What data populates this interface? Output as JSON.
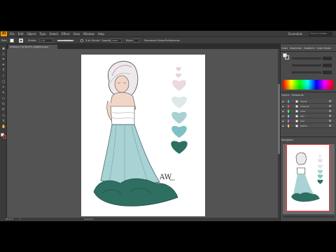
{
  "app": {
    "logo_text": "Ai",
    "menu": [
      "File",
      "Edit",
      "Object",
      "Type",
      "Select",
      "Effect",
      "View",
      "Window",
      "Help"
    ],
    "workspace": "Essentials",
    "stock_search_placeholder": "Search Adobe Stock"
  },
  "control_bar": {
    "selection_label": "Path",
    "stroke_label": "Stroke:",
    "stroke_value": "1 pt",
    "stroke_profile": "Uniform",
    "brush_label": "5 pt. Round",
    "opacity_label": "Opacity:",
    "opacity_value": "100%",
    "style_label": "Style:",
    "doc_setup_label": "Document Setup",
    "preferences_label": "Preferences"
  },
  "document": {
    "tab_title": "Untitled-1* @ 66.67% (RGB/Preview)",
    "zoom": "66.67%",
    "artboard_number": "1",
    "status_tool": "Selection"
  },
  "panels": {
    "color_tabs": [
      "Color",
      "Swatches",
      "Gradient",
      "Color Guide"
    ],
    "layers_tabs": [
      "Layers",
      "Artboards"
    ],
    "layers": [
      {
        "name": "hearts",
        "color": "#4aa3ff"
      },
      {
        "name": "linework",
        "color": "#ff4a4a"
      },
      {
        "name": "color",
        "color": "#4aff6a"
      },
      {
        "name": "skin",
        "color": "#4ad0ff"
      },
      {
        "name": "hair",
        "color": "#ff4aff"
      },
      {
        "name": "sketch",
        "color": "#ffd04a"
      }
    ],
    "navigator_title": "Navigator"
  },
  "artwork": {
    "signature": "AW",
    "signature_year": "2019",
    "hearts": [
      "#e9cdd6",
      "#ecd2db",
      "#ead9de",
      "#dfe8e8",
      "#a9d1d3",
      "#7dc1c4",
      "#2f6f62"
    ]
  }
}
